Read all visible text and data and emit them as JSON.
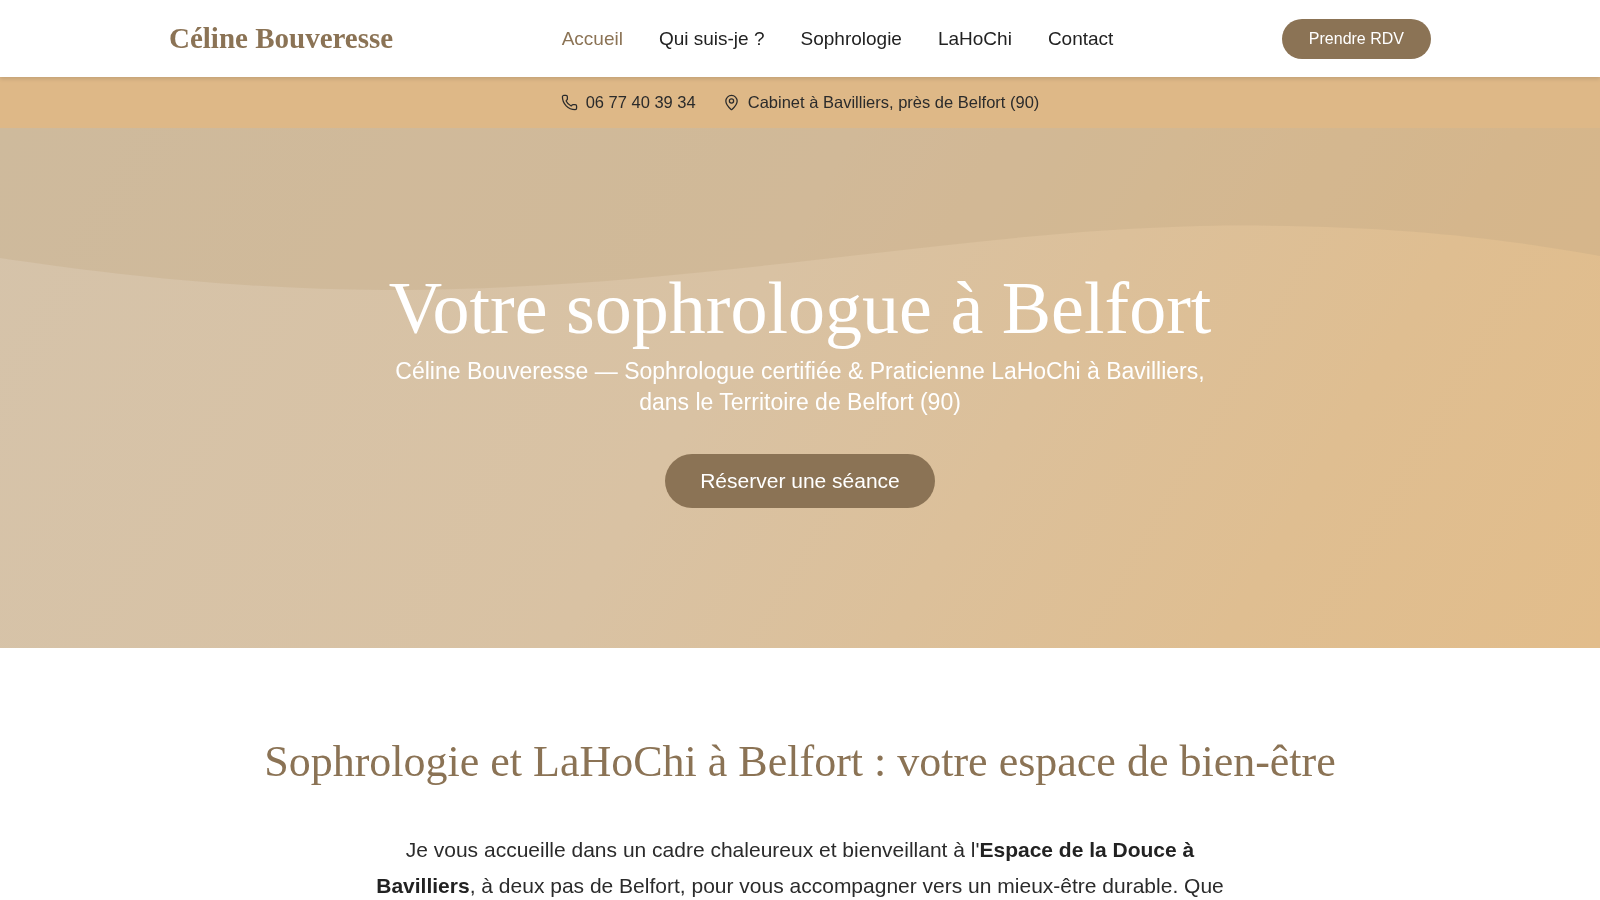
{
  "header": {
    "logo": "Céline Bouveresse",
    "nav": [
      {
        "label": "Accueil",
        "selected": true
      },
      {
        "label": "Qui suis-je ?",
        "selected": false
      },
      {
        "label": "Sophrologie",
        "selected": false
      },
      {
        "label": "LaHoChi",
        "selected": false
      },
      {
        "label": "Contact",
        "selected": false
      }
    ],
    "cta": "Prendre RDV"
  },
  "info_bar": {
    "items": [
      {
        "kind": "phone",
        "text": "06 77 40 39 34"
      },
      {
        "kind": "location",
        "text": "Cabinet à Bavilliers, près de Belfort (90)"
      }
    ]
  },
  "hero": {
    "title": "Votre sophrologue à Belfort",
    "subtitle": "Céline Bouveresse — Sophrologue certifiée & Praticienne LaHoChi à Bavilliers, dans le Territoire de Belfort (90)",
    "button": "Réserver une séance"
  },
  "intro": {
    "heading": "Sophrologie et LaHoChi à Belfort : votre espace de bien-être",
    "paragraph": "Je vous accueille dans un cadre chaleureux et bienveillant à l'**Espace de la Douce à Bavilliers**, à deux pas de Belfort, pour vous accompagner vers un mieux-être durable. Que"
  }
}
